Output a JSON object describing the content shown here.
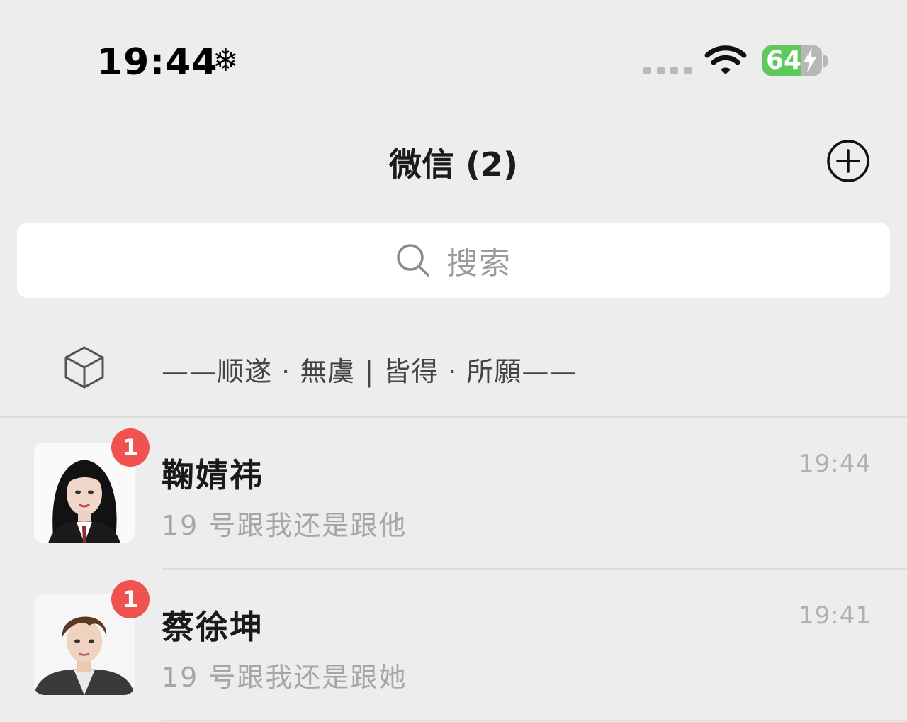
{
  "status_bar": {
    "time": "19:44",
    "snow_icon": "❄",
    "battery_level": "64",
    "battery_percent": 64,
    "battery_color": "#5cc95a"
  },
  "nav": {
    "title": "微信 (2)",
    "add_icon": "plus-circle-icon"
  },
  "search": {
    "placeholder": "搜索",
    "icon": "search-icon"
  },
  "status_row": {
    "icon": "cube-icon",
    "text": "——顺遂 · 無虞 | 皆得 · 所願——"
  },
  "chats": [
    {
      "name": "鞠婧祎",
      "message": "19 号跟我还是跟他",
      "time": "19:44",
      "unread": "1"
    },
    {
      "name": "蔡徐坤",
      "message": "19 号跟我还是跟她",
      "time": "19:41",
      "unread": "1"
    }
  ],
  "colors": {
    "background": "#ededed",
    "badge": "#f0524f",
    "battery": "#5cc95a"
  }
}
